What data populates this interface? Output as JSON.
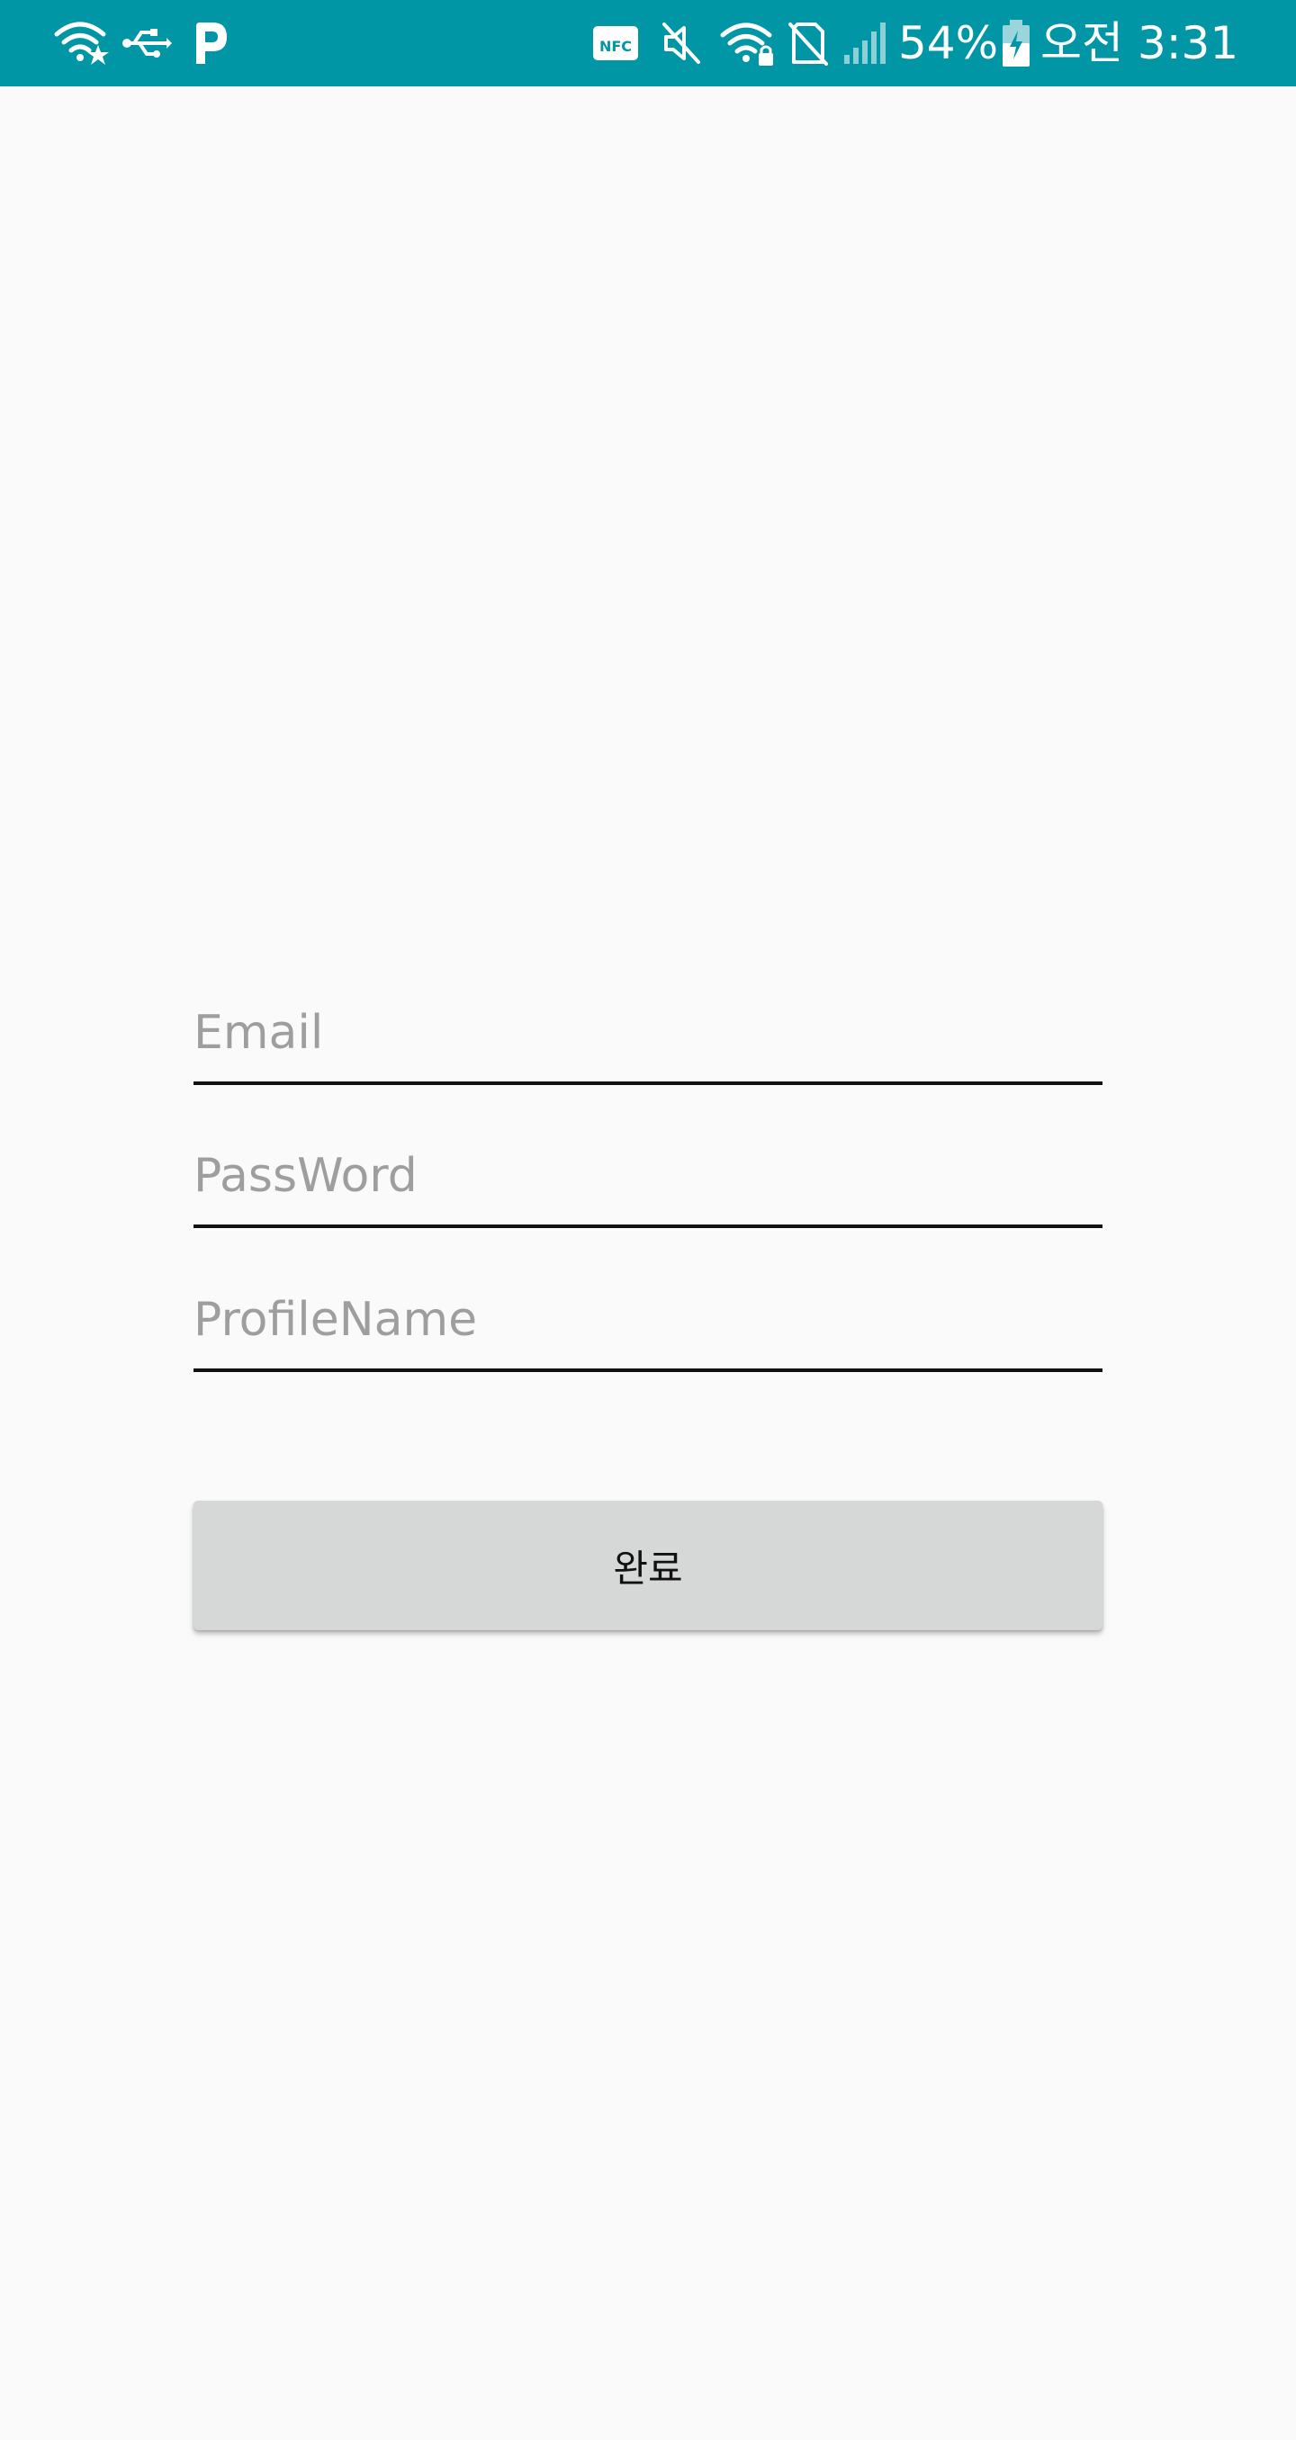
{
  "status_bar": {
    "background_color": "#0096a6",
    "left_icons": [
      "wifi-star-icon",
      "usb-icon",
      "parking-p-icon"
    ],
    "right_icons": [
      "nfc-icon",
      "mute-icon",
      "wifi-lock-icon",
      "no-sim-icon",
      "signal-icon",
      "battery-charging-icon"
    ],
    "nfc_label": "NFC",
    "battery_percent": "54%",
    "time": "오전 3:31"
  },
  "form": {
    "email": {
      "placeholder": "Email",
      "value": ""
    },
    "password": {
      "placeholder": "PassWord",
      "value": ""
    },
    "profile_name": {
      "placeholder": "ProfileName",
      "value": ""
    },
    "submit_label": "완료"
  },
  "colors": {
    "background": "#fafafa",
    "button_bg": "#d6d7d7",
    "placeholder_text": "#9e9e9e",
    "underline": "#111111"
  }
}
